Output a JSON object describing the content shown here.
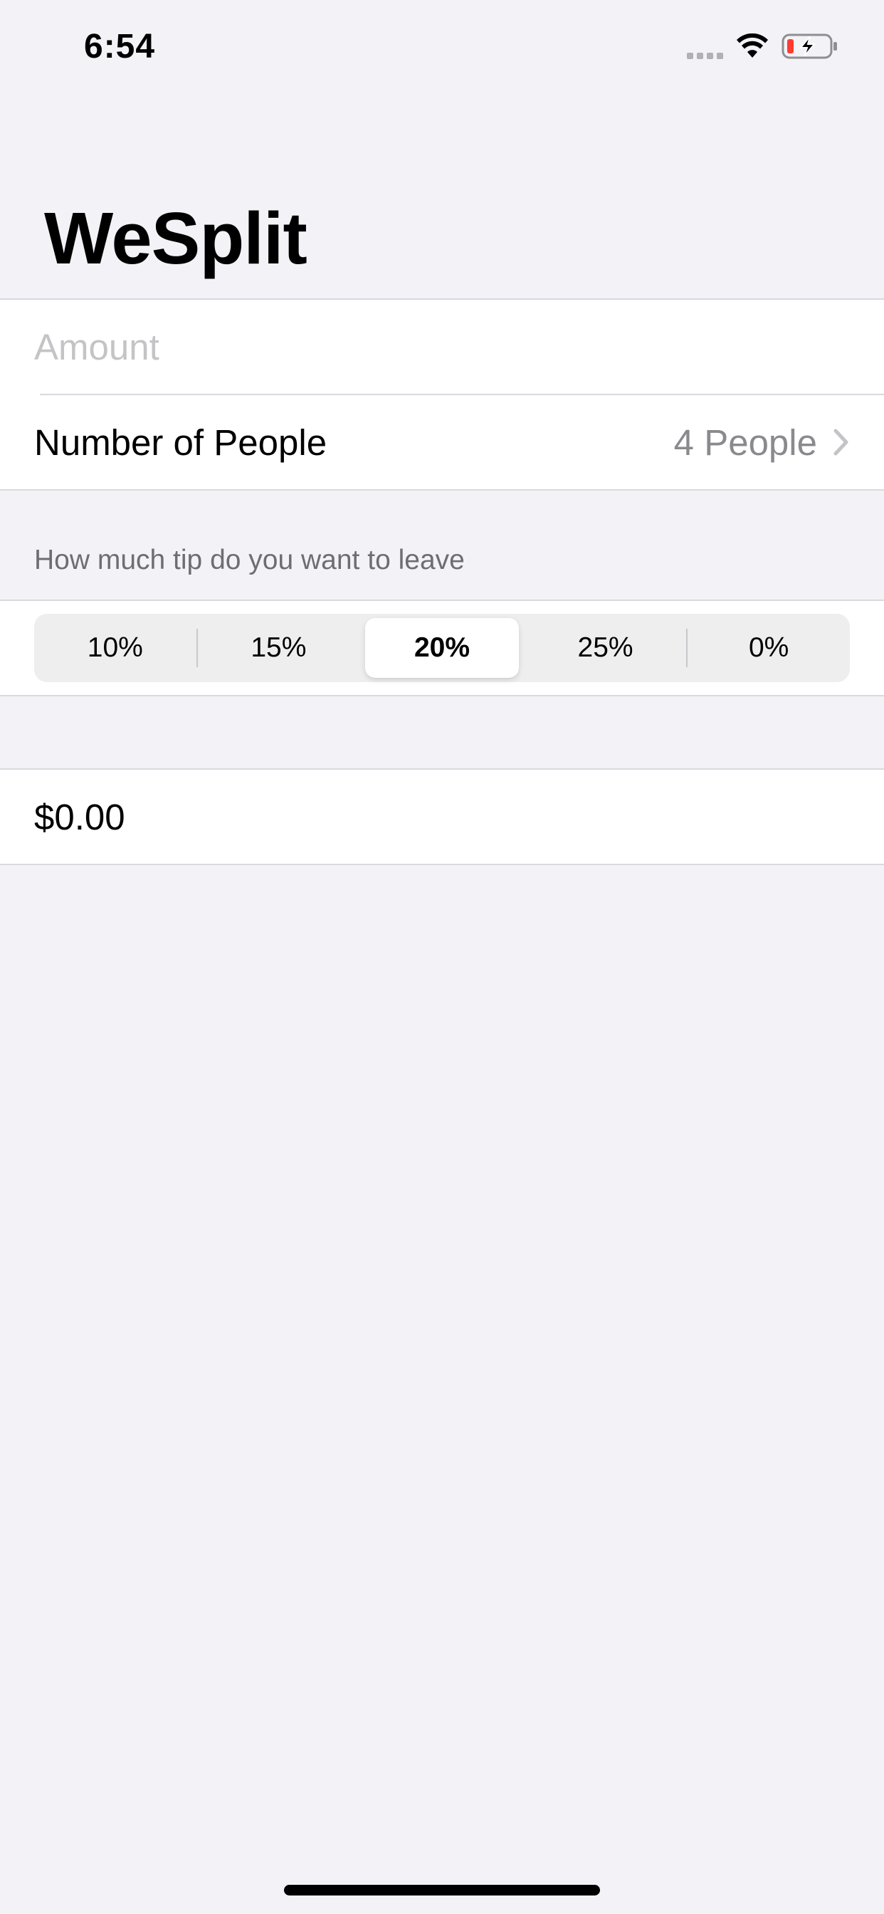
{
  "status_bar": {
    "time": "6:54",
    "icons": [
      "signal-icon",
      "wifi-icon",
      "battery-charging-icon"
    ],
    "battery_low_color": "#ff3b30"
  },
  "title": "WeSplit",
  "form": {
    "amount": {
      "value": "",
      "placeholder": "Amount"
    },
    "people": {
      "label": "Number of People",
      "value": "4 People",
      "icon": "chevron-right-icon"
    }
  },
  "tip": {
    "header": "How much tip do you want to leave",
    "options": [
      "10%",
      "15%",
      "20%",
      "25%",
      "0%"
    ],
    "selected": "20%"
  },
  "result": {
    "amount": "$0.00"
  },
  "colors": {
    "background": "#f2f2f7",
    "secondary_text": "#8a8a8e",
    "placeholder": "#c4c4c7"
  }
}
